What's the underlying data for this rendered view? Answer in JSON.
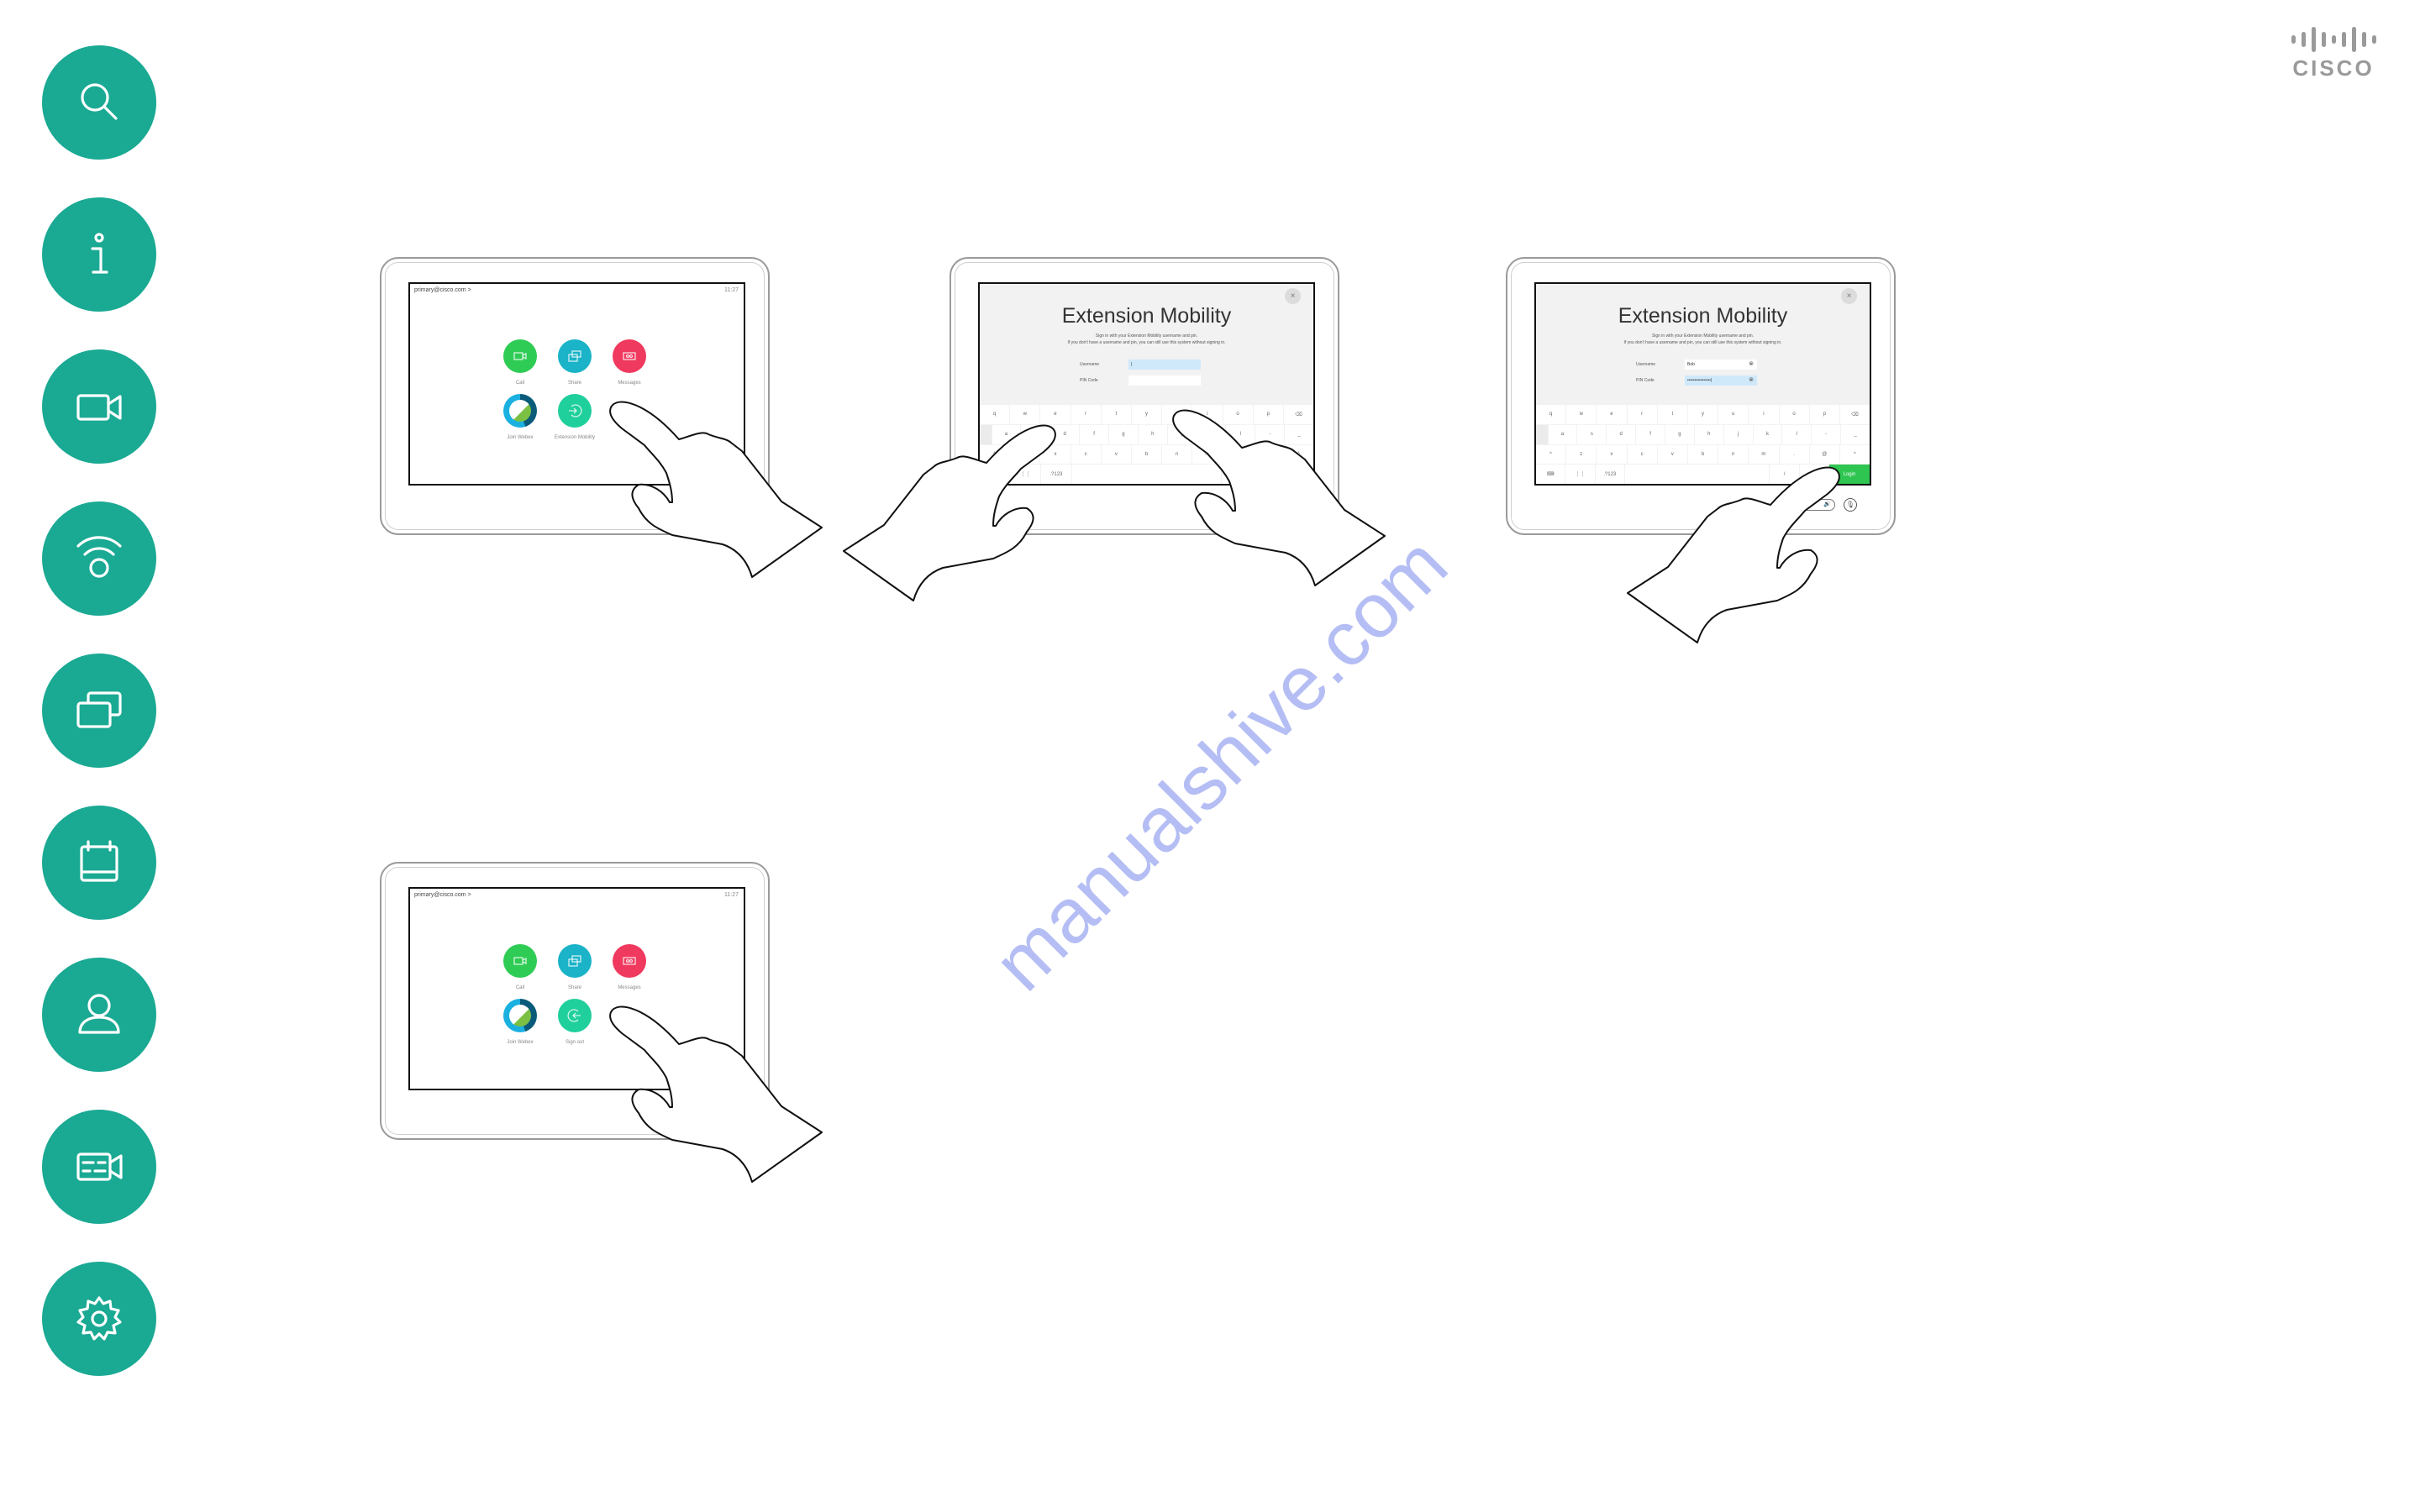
{
  "sidebar": {
    "color": "#1aa993",
    "items": [
      {
        "icon": "search-icon"
      },
      {
        "icon": "info-icon"
      },
      {
        "icon": "video-camera-icon"
      },
      {
        "icon": "wireless-icon"
      },
      {
        "icon": "share-screens-icon"
      },
      {
        "icon": "calendar-icon"
      },
      {
        "icon": "person-icon"
      },
      {
        "icon": "video-settings-icon"
      },
      {
        "icon": "gear-icon"
      }
    ]
  },
  "logo": {
    "text": "CISCO"
  },
  "home": {
    "account": "primary@cisco.com >",
    "time": "11:27",
    "apps": [
      {
        "label": "Call",
        "color": "#2fcc55"
      },
      {
        "label": "Share",
        "color": "#1ab3c8"
      },
      {
        "label": "Messages",
        "color": "#f0395e"
      },
      {
        "label": "Join Webex"
      },
      {
        "label": "Extension Mobility",
        "color": "#1fcf9c"
      }
    ],
    "signout_label": "Sign out"
  },
  "extension_mobility": {
    "title": "Extension Mobility",
    "subtitle_1": "Sign in with your Extension Mobility username and pin.",
    "subtitle_2": "If you don't have a username and pin, you can still use this system without signing in.",
    "username_label": "Username",
    "pin_label": "PIN Code",
    "username_empty": "|",
    "username_value": "Bob",
    "pin_value": "••••••••••••••••|",
    "close": "×",
    "clear": "⊗",
    "login_label": "Login",
    "keys_row1": [
      "q",
      "w",
      "e",
      "r",
      "t",
      "y",
      "u",
      "i",
      "o",
      "p",
      "⌫"
    ],
    "keys_row2": [
      "a",
      "s",
      "d",
      "f",
      "g",
      "h",
      "j",
      "k",
      "l",
      "-",
      "_"
    ],
    "keys_row3": [
      "^",
      "z",
      "x",
      "c",
      "v",
      "b",
      "n",
      "m",
      ".",
      "@",
      "^"
    ],
    "keys_row4": [
      "⌨",
      "⋮⋮",
      ".?123",
      "",
      "/",
      ".com"
    ],
    "volume": "🔊",
    "mute": "🎙"
  },
  "watermark": "manualshive.com"
}
